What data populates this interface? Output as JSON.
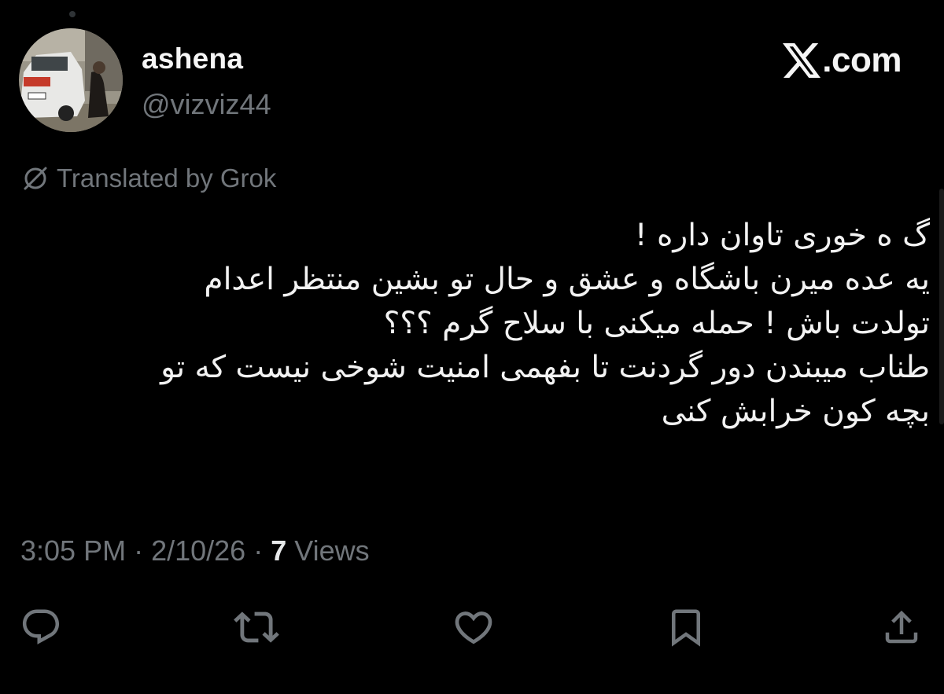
{
  "author": {
    "display_name": "ashena",
    "handle": "@vizviz44",
    "avatar": "avatar-photo"
  },
  "brand": {
    "logo": "x-logo-icon",
    "text": ".com"
  },
  "translation_notice": {
    "icon": "translate-globe-icon",
    "text": "Translated by Grok"
  },
  "tweet": {
    "direction": "rtl",
    "lines": [
      "گ ه خوری تاوان داره !",
      "یه عده میرن باشگاه و عشق و حال تو بشین منتظر اعدام",
      "تولدت باش ! حمله میکنی با سلاح گرم ؟؟؟",
      "طناب میبندن دور گردنت تا بفهمی امنیت شوخی نیست که تو",
      "بچه کون خرابش کنی"
    ]
  },
  "meta": {
    "time": "3:05 PM",
    "separator": " · ",
    "date": "2/10/26",
    "views_count": "7",
    "views_label": " Views"
  },
  "actions": [
    {
      "name": "reply",
      "icon": "reply-icon"
    },
    {
      "name": "repost",
      "icon": "repost-icon"
    },
    {
      "name": "like",
      "icon": "heart-icon"
    },
    {
      "name": "bookmark",
      "icon": "bookmark-icon"
    },
    {
      "name": "share",
      "icon": "share-icon"
    }
  ],
  "colors": {
    "background": "#000000",
    "primary_text": "#e7e9ea",
    "secondary_text": "#71767b"
  }
}
